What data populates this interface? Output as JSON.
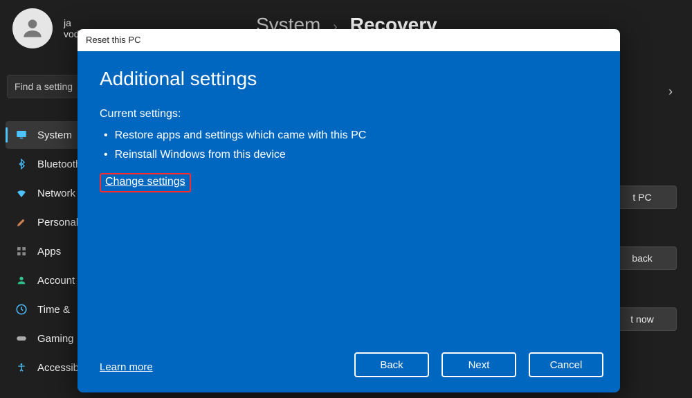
{
  "user": {
    "name_partial": "ja",
    "sub": "vod"
  },
  "breadcrumb": {
    "parent": "System",
    "current": "Recovery"
  },
  "search": {
    "placeholder": "Find a setting"
  },
  "sidebar": {
    "items": [
      {
        "label": "System",
        "icon": "monitor-icon",
        "color": "#4cc2ff",
        "active": true
      },
      {
        "label": "Bluetooth",
        "icon": "bluetooth-icon",
        "color": "#4cc2ff",
        "active": false
      },
      {
        "label": "Network",
        "icon": "wifi-icon",
        "color": "#4cc2ff",
        "active": false
      },
      {
        "label": "Personal",
        "icon": "brush-icon",
        "color": "#d08050",
        "active": false
      },
      {
        "label": "Apps",
        "icon": "apps-icon",
        "color": "#888",
        "active": false
      },
      {
        "label": "Account",
        "icon": "person-icon",
        "color": "#2fc28c",
        "active": false
      },
      {
        "label": "Time &",
        "icon": "clock-icon",
        "color": "#4cc2ff",
        "active": false
      },
      {
        "label": "Gaming",
        "icon": "gamepad-icon",
        "color": "#aaa",
        "active": false
      },
      {
        "label": "Accessibility",
        "icon": "accessibility-icon",
        "color": "#4cc2ff",
        "active": false
      }
    ]
  },
  "right_partial_buttons": {
    "b1": "t PC",
    "b2": "back",
    "b3": "t now"
  },
  "modal": {
    "title": "Reset this PC",
    "heading": "Additional settings",
    "current_label": "Current settings:",
    "settings": [
      "Restore apps and settings which came with this PC",
      "Reinstall Windows from this device"
    ],
    "change_link": "Change settings",
    "learn_more": "Learn more",
    "buttons": {
      "back": "Back",
      "next": "Next",
      "cancel": "Cancel"
    }
  }
}
